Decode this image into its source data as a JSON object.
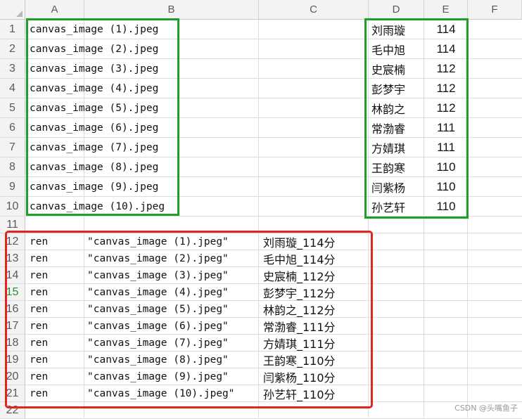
{
  "columns": [
    "A",
    "B",
    "C",
    "D",
    "E",
    "F"
  ],
  "row_numbers": [
    "1",
    "2",
    "3",
    "4",
    "5",
    "6",
    "7",
    "8",
    "9",
    "10",
    "11",
    "12",
    "13",
    "14",
    "15",
    "16",
    "17",
    "18",
    "19",
    "20",
    "21",
    "22"
  ],
  "selected_row": "15",
  "files": [
    "canvas_image (1).jpeg",
    "canvas_image (2).jpeg",
    "canvas_image (3).jpeg",
    "canvas_image (4).jpeg",
    "canvas_image (5).jpeg",
    "canvas_image (6).jpeg",
    "canvas_image (7).jpeg",
    "canvas_image (8).jpeg",
    "canvas_image (9).jpeg",
    "canvas_image (10).jpeg"
  ],
  "names": [
    "刘雨璇",
    "毛中旭",
    "史宸楠",
    "彭梦宇",
    "林韵之",
    "常渤睿",
    "方婧琪",
    "王韵寒",
    "闫紫杨",
    "孙艺轩"
  ],
  "scores": [
    "114",
    "114",
    "112",
    "112",
    "112",
    "111",
    "111",
    "110",
    "110",
    "110"
  ],
  "commands": [
    {
      "a": "ren",
      "b": "\"canvas_image (1).jpeg\"",
      "c": "刘雨璇_114分"
    },
    {
      "a": "ren",
      "b": "\"canvas_image (2).jpeg\"",
      "c": "毛中旭_114分"
    },
    {
      "a": "ren",
      "b": "\"canvas_image (3).jpeg\"",
      "c": "史宸楠_112分"
    },
    {
      "a": "ren",
      "b": "\"canvas_image (4).jpeg\"",
      "c": "彭梦宇_112分"
    },
    {
      "a": "ren",
      "b": "\"canvas_image (5).jpeg\"",
      "c": "林韵之_112分"
    },
    {
      "a": "ren",
      "b": "\"canvas_image (6).jpeg\"",
      "c": "常渤睿_111分"
    },
    {
      "a": "ren",
      "b": "\"canvas_image (7).jpeg\"",
      "c": "方婧琪_111分"
    },
    {
      "a": "ren",
      "b": "\"canvas_image (8).jpeg\"",
      "c": "王韵寒_110分"
    },
    {
      "a": "ren",
      "b": "\"canvas_image (9).jpeg\"",
      "c": "闫紫杨_110分"
    },
    {
      "a": "ren",
      "b": "\"canvas_image (10).jpeg\"",
      "c": "孙艺轩_110分"
    }
  ],
  "watermark": "CSDN @头嘴鱼子",
  "colors": {
    "green_box": "#1f9e2a",
    "red_box": "#e0271f",
    "header_bg": "#f3f3f3",
    "grid_line": "#dcdcdc"
  }
}
